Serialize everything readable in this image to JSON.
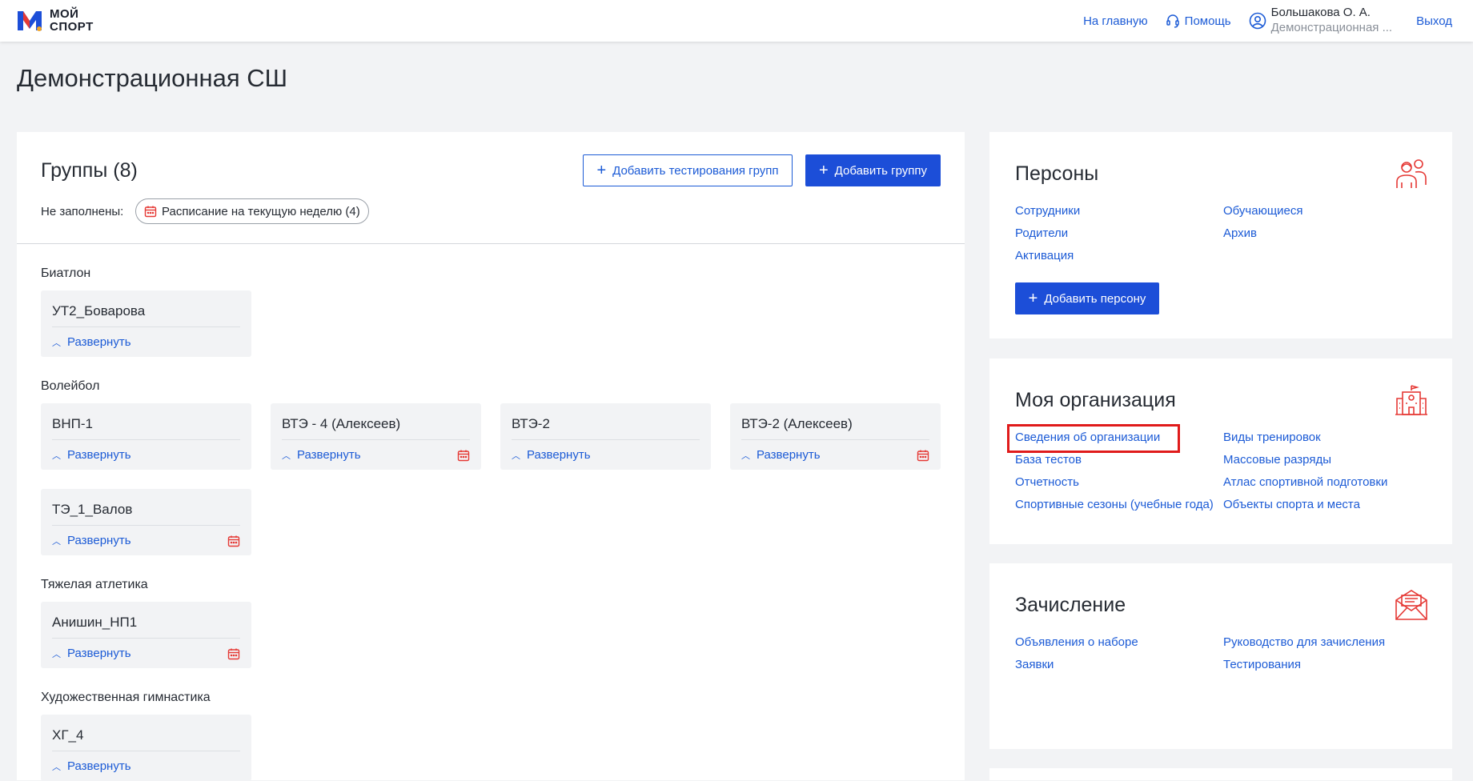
{
  "header": {
    "logo_line1": "МОЙ",
    "logo_line2": "СПОРТ",
    "home_link": "На главную",
    "help_link": "Помощь",
    "user_name": "Большакова О. А.",
    "user_org": "Демонстрационная ...",
    "logout_link": "Выход"
  },
  "page_title": "Демонстрационная СШ",
  "groups": {
    "title": "Группы (8)",
    "add_testing_label": "Добавить тестирования групп",
    "add_group_label": "Добавить группу",
    "unfilled_label": "Не заполнены:",
    "chip_label": "Расписание на текущую неделю (4)",
    "expand_label": "Развернуть",
    "sports": [
      {
        "name": "Биатлон",
        "groups": [
          {
            "name": "УТ2_Боварова",
            "calendar": false
          }
        ]
      },
      {
        "name": "Волейбол",
        "groups": [
          {
            "name": "ВНП-1",
            "calendar": false
          },
          {
            "name": "ВТЭ - 4 (Алексеев)",
            "calendar": true
          },
          {
            "name": "ВТЭ-2",
            "calendar": false
          },
          {
            "name": "ВТЭ-2 (Алексеев)",
            "calendar": true
          },
          {
            "name": "ТЭ_1_Валов",
            "calendar": true
          }
        ]
      },
      {
        "name": "Тяжелая атлетика",
        "groups": [
          {
            "name": "Анишин_НП1",
            "calendar": true
          }
        ]
      },
      {
        "name": "Художественная гимнастика",
        "groups": [
          {
            "name": "ХГ_4",
            "calendar": false
          }
        ]
      }
    ]
  },
  "persons": {
    "title": "Персоны",
    "links": [
      "Сотрудники",
      "Обучающиеся",
      "Родители",
      "Архив",
      "Активация"
    ],
    "add_person_label": "Добавить персону"
  },
  "organization": {
    "title": "Моя организация",
    "links": [
      "Сведения об организации",
      "Виды тренировок",
      "База тестов",
      "Массовые разряды",
      "Отчетность",
      "Атлас спортивной подготовки",
      "Спортивные сезоны (учебные года)",
      "Объекты спорта и места"
    ]
  },
  "enrollment": {
    "title": "Зачисление",
    "links": [
      "Объявления о наборе",
      "Руководство для зачисления",
      "Заявки",
      "Тестирования"
    ]
  },
  "colors": {
    "accent": "#1c5bd6",
    "primary_button": "#1c4ed8",
    "icon_red": "#e53935",
    "highlight": "#e01b1b"
  }
}
